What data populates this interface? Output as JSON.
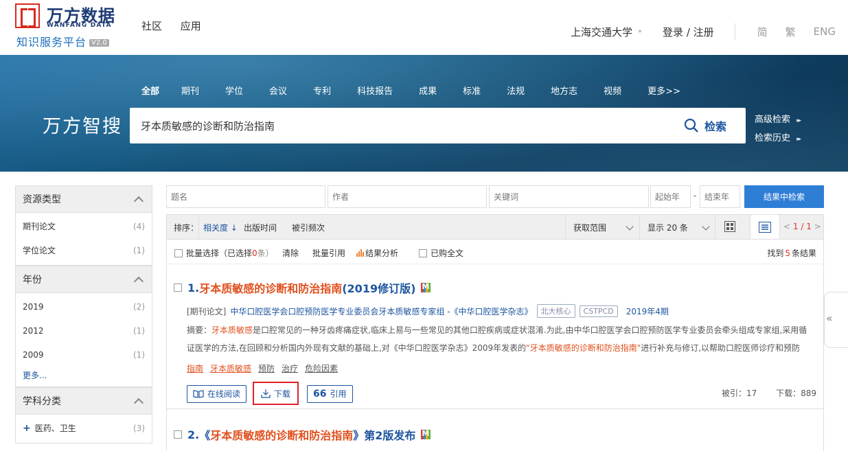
{
  "logo": {
    "cn": "万方数据",
    "en": "WANFANG DATA",
    "sub": "知识服务平台",
    "ver": "V2.0"
  },
  "topnav": [
    "社区",
    "应用"
  ],
  "topright": {
    "institution": "上海交通大学",
    "login": "登录 / 注册",
    "langs": [
      "简",
      "繁",
      "ENG"
    ]
  },
  "hero": {
    "categories": [
      "全部",
      "期刊",
      "学位",
      "会议",
      "专利",
      "科技报告",
      "成果",
      "标准",
      "法规",
      "地方志",
      "视频",
      "更多>>"
    ],
    "brand": "万方智搜",
    "query": "牙本质敏感的诊断和防治指南",
    "search_label": "检索",
    "advanced": "高级检索",
    "history": "检索历史"
  },
  "facets": [
    {
      "title": "资源类型",
      "items": [
        {
          "label": "期刊论文",
          "count": "(4)"
        },
        {
          "label": "学位论文",
          "count": "(1)"
        }
      ]
    },
    {
      "title": "年份",
      "items": [
        {
          "label": "2019",
          "count": "(2)"
        },
        {
          "label": "2012",
          "count": "(1)"
        },
        {
          "label": "2009",
          "count": "(1)"
        }
      ],
      "more": "更多..."
    },
    {
      "title": "学科分类",
      "items": [
        {
          "label": "医药、卫生",
          "count": "(3)"
        }
      ]
    }
  ],
  "filters": {
    "title": "题名",
    "author": "作者",
    "keyword": "关键词",
    "start_year": "起始年",
    "dash": "-",
    "end_year": "结束年",
    "button": "结果中检索"
  },
  "sortbar": {
    "label": "排序：",
    "relevance": "相关度",
    "pubtime": "出版时间",
    "cited": "被引频次",
    "scope": "获取范围",
    "display": "显示 20 条",
    "pager_prev": "<",
    "pager_cur": "1",
    "pager_total": "/ 1",
    "pager_next": ">"
  },
  "toolbar": {
    "batch": "批量选择（已选择",
    "sel_count": "0",
    "batch_end": "条）",
    "clear": "清除",
    "cite": "批量引用",
    "analysis": "结果分析",
    "purchased": "已购全文",
    "found_pre": "找到",
    "found_count": "5",
    "found_post": "条结果"
  },
  "results": [
    {
      "num": "1.",
      "title_hl": "牙本质敏感的诊断和防治指南",
      "title_rest": "(2019修订版)",
      "type": "[期刊论文]",
      "authors": "中华口腔医学会口腔预防医学专业委员会牙本质敏感专家组  -《中华口腔医学杂志》",
      "tags": [
        "北大核心",
        "CSTPCD"
      ],
      "date": "2019年4期",
      "abstract_pre": "摘要：",
      "abstract_hl": "牙本质敏感",
      "abstract_mid": "是口腔常见的一种牙齿疼痛症状,临床上易与一些常见的其他口腔疾病或症状混淆.为此,由中华口腔医学会口腔预防医学专业委员会牵头组成专家组,采用循证医学的方法,在回顾和分析国内外现有文献的基础上,对《中华口腔医学杂志》2009年发表的",
      "abstract_hl2": "\"牙本质敏感的诊断和防治指南\"",
      "abstract_end": "进行补充与修订,以帮助口腔医师诊疗和预防牙…",
      "keywords_hl": [
        "指南",
        "牙本质敏感"
      ],
      "keywords": [
        "预防",
        "治疗",
        "危险因素"
      ],
      "actions": {
        "read": "在线阅读",
        "download": "下载",
        "cite": "引用"
      },
      "cited_label": "被引：",
      "cited": "17",
      "downloads_label": "下载：",
      "downloads": "889"
    },
    {
      "num": "2.",
      "title_pre": "《",
      "title_hl": "牙本质敏感的诊断和防治指南",
      "title_rest": "》第2版发布"
    }
  ]
}
